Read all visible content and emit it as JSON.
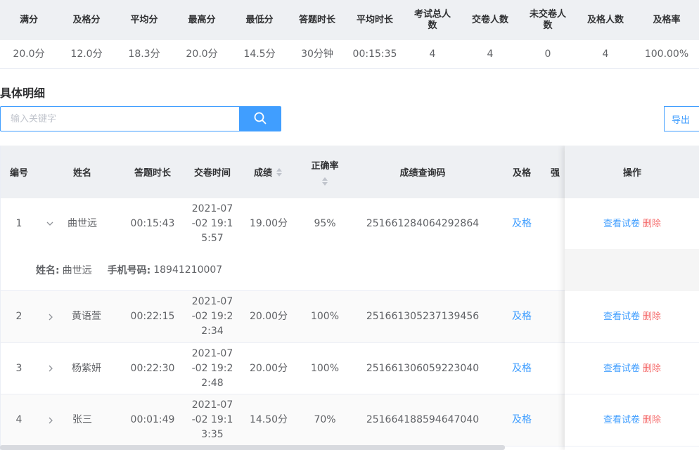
{
  "summary": {
    "headers": [
      "满分",
      "及格分",
      "平均分",
      "最高分",
      "最低分",
      "答题时长",
      "平均时长",
      "考试总人数",
      "交卷人数",
      "未交卷人数",
      "及格人数",
      "及格率"
    ],
    "values": [
      "20.0分",
      "12.0分",
      "18.3分",
      "20.0分",
      "14.5分",
      "30分钟",
      "00:15:35",
      "4",
      "4",
      "0",
      "4",
      "100.00%"
    ]
  },
  "section_title": "具体明细",
  "search": {
    "placeholder": "输入关键字"
  },
  "export_label": "导出",
  "detail": {
    "headers": {
      "no": "编号",
      "name": "姓名",
      "duration": "答题时长",
      "submit_time": "交卷时间",
      "score": "成绩",
      "accuracy": "正确率",
      "code": "成绩查询码",
      "pass": "及格",
      "partial": "强",
      "actions": "操作"
    },
    "rows": [
      {
        "no": "1",
        "name": "曲世远",
        "duration": "00:15:43",
        "submit_time": "2021-07\n-02 19:1\n5:57",
        "score": "19.00分",
        "accuracy": "95%",
        "code": "251661284064292864",
        "pass": "及格",
        "view": "查看试卷",
        "delete": "删除",
        "expanded": true
      },
      {
        "no": "2",
        "name": "黄语萱",
        "duration": "00:22:15",
        "submit_time": "2021-07\n-02 19:2\n2:34",
        "score": "20.00分",
        "accuracy": "100%",
        "code": "251661305237139456",
        "pass": "及格",
        "view": "查看试卷",
        "delete": "删除",
        "expanded": false
      },
      {
        "no": "3",
        "name": "杨紫妍",
        "duration": "00:22:30",
        "submit_time": "2021-07\n-02 19:2\n2:48",
        "score": "20.00分",
        "accuracy": "100%",
        "code": "251661306059223040",
        "pass": "及格",
        "view": "查看试卷",
        "delete": "删除",
        "expanded": false
      },
      {
        "no": "4",
        "name": "张三",
        "duration": "00:01:49",
        "submit_time": "2021-07\n-02 19:1\n3:35",
        "score": "14.50分",
        "accuracy": "70%",
        "code": "251664188594647040",
        "pass": "及格",
        "view": "查看试卷",
        "delete": "删除",
        "expanded": false
      }
    ],
    "expand_info": {
      "name_label": "姓名:",
      "name_value": "曲世远",
      "phone_label": "手机号码:",
      "phone_value": "18941210007"
    }
  },
  "colors": {
    "primary": "#409eff",
    "danger": "#f56c6c",
    "header_bg": "#eef0f3"
  },
  "icons": {
    "search": "search-icon",
    "expand": "chevron-icon",
    "sort": "sort-caret-icon"
  }
}
